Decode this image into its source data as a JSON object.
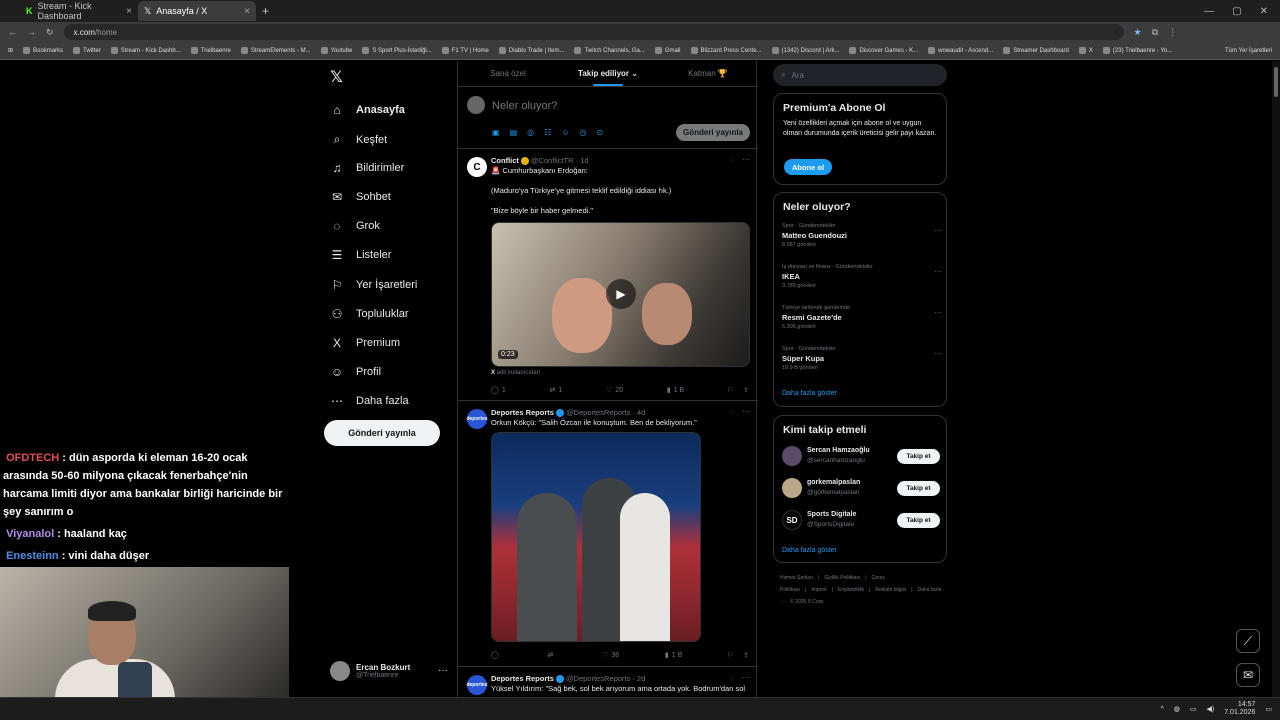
{
  "browser": {
    "tabs": [
      {
        "title": "Stream - Kick Dashboard",
        "active": false
      },
      {
        "title": "Anasayfa / X",
        "active": true
      }
    ],
    "url_host": "x.com",
    "url_path": "/home",
    "bookmarks": [
      "Bookmarks",
      "Twitter",
      "Stream - Kick Dashb...",
      "Trielbaenre",
      "StreamElements - M...",
      "Youtube",
      "S Sport Plus-İstediği...",
      "F1 TV | Home",
      "Diablo Trade | Item...",
      "Twitch Channels, Ga...",
      "Gmail",
      "Blizzard Press Cente...",
      "(1342) Discord | Ark...",
      "Discover Games - K...",
      "wowaudit - Ascend...",
      "Streamer Dashboard",
      "X",
      "(23) Trielbaenre - Yo..."
    ],
    "all_bookmarks": "Tüm Yer İşaretleri"
  },
  "nav": {
    "items": [
      {
        "label": "Anasayfa",
        "icon": "⌂",
        "bold": true
      },
      {
        "label": "Keşfet",
        "icon": "⌕",
        "bold": false
      },
      {
        "label": "Bildirimler",
        "icon": "♫",
        "bold": false
      },
      {
        "label": "Sohbet",
        "icon": "✉",
        "bold": false
      },
      {
        "label": "Grok",
        "icon": "◌",
        "bold": false
      },
      {
        "label": "Listeler",
        "icon": "☰",
        "bold": false
      },
      {
        "label": "Yer İşaretleri",
        "icon": "⚐",
        "bold": false
      },
      {
        "label": "Topluluklar",
        "icon": "⚇",
        "bold": false
      },
      {
        "label": "Premium",
        "icon": "X",
        "bold": false
      },
      {
        "label": "Profil",
        "icon": "☺",
        "bold": false
      },
      {
        "label": "Daha fazla",
        "icon": "⋯",
        "bold": false
      }
    ],
    "post_button": "Gönderi yayınla",
    "user_name": "Ercan Bozkurt",
    "user_handle": "@Trielbaenre"
  },
  "chat": [
    {
      "user": "OFDTECH",
      "msg": " : dün asporda ki eleman 16-20 ocak arasında 50-60 milyona çıkacak fenerbahçe'nin harcama limiti diyor ama bankalar birliği haricinde bir şey sanırım o"
    },
    {
      "user": "Viyanalol",
      "msg": " : haaland kaç"
    },
    {
      "user": "Enesteinn",
      "msg": " : vini daha düşer"
    }
  ],
  "feed": {
    "tabs": [
      "Sana özel",
      "Takip ediliyor ⌄",
      "Katman 🏆"
    ],
    "compose_placeholder": "Neler oluyor?",
    "compose_button": "Gönderi yayınla",
    "tweets": [
      {
        "name": "Conflict",
        "handle": "@ConflictTR · 1d",
        "lines": [
          "🚨 Cumhurbaşkanı Erdoğan:",
          "(Maduro'ya Türkiye'ye gitmesi teklif edildiği iddiası hk.)",
          "\"Bize böyle bir haber gelmedi.\""
        ],
        "duration": "0:23",
        "source_prefix": "X",
        "source": " adlı kullanıcıdan",
        "stats": {
          "replies": "1",
          "reposts": "1",
          "likes": "20",
          "views": "1 B"
        }
      },
      {
        "name": "Deportes Reports",
        "handle": "@DeportesReports · 4d",
        "lines": [
          "Orkun Kökçü: \"Salih Özcan ile konuştum. Ben de bekliyorum.\""
        ],
        "stats": {
          "replies": "",
          "reposts": "",
          "likes": "36",
          "views": "1 B"
        }
      },
      {
        "name": "Deportes Reports",
        "handle": "@DeportesReports · 2d",
        "lines": [
          "Yüksel Yıldırım: \"Sağ bek, sol bek arıyorum ama ortada yok. Bodrum'dan sol"
        ]
      }
    ]
  },
  "right": {
    "search_placeholder": "Ara",
    "premium": {
      "title": "Premium'a Abone Ol",
      "text": "Yeni özellikleri açmak için abone ol ve uygun olman durumunda içerik üreticisi gelir payı kazan.",
      "button": "Abone ol"
    },
    "trends_title": "Neler oluyor?",
    "trends": [
      {
        "cat": "Spor · Gündemdekiler",
        "name": "Matteo Guendouzi",
        "count": "8.687 gönderi"
      },
      {
        "cat": "İş dünyası ve finans · Gündemdekiler",
        "name": "IKEA",
        "count": "3.789 gönderi"
      },
      {
        "cat": "Türkiye tarihinde gündemde",
        "name": "Resmi Gazete'de",
        "count": "5.305 gönderi"
      },
      {
        "cat": "Spor · Gündemdekiler",
        "name": "Süper Kupa",
        "count": "19,9 B gönderi"
      }
    ],
    "show_more": "Daha fazla göster",
    "who_title": "Kimi takip etmeli",
    "who": [
      {
        "name": "Sercan Hamzaoğlu",
        "handle": "@sercanhamzaoglu",
        "btn": "Takip et"
      },
      {
        "name": "gorkemalpaslan",
        "handle": "@gorkemalpaslan",
        "btn": "Takip et"
      },
      {
        "name": "Sports Digitale",
        "handle": "@SportsDigitale",
        "btn": "Takip et"
      }
    ],
    "footer": [
      "Hizmet Şartları",
      "|",
      "Gizlilik Politikası",
      "|",
      "Çerez Politikası",
      "|",
      "Imprint",
      "|",
      "Erişilebilirlik",
      "|",
      "Reklam bilgisi",
      "|",
      "Daha fazla ···",
      "© 2026 X Corp."
    ]
  },
  "taskbar": {
    "time": "14:57",
    "date": "7.01.2026"
  },
  "colors": {
    "accent": "#1d9bf0",
    "background": "#000000",
    "border": "#2f3336"
  }
}
